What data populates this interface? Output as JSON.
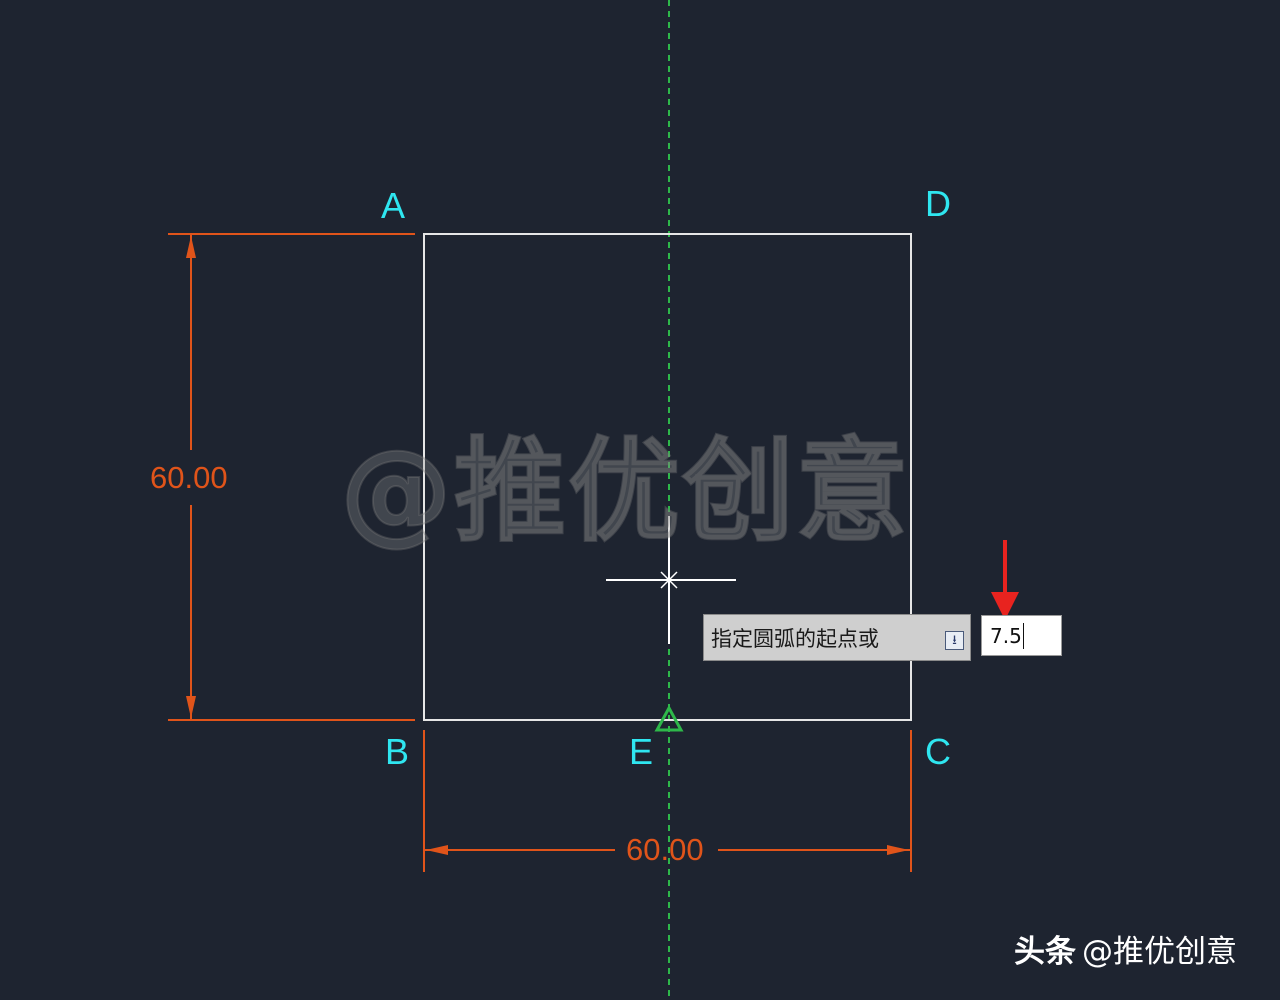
{
  "drawing": {
    "points": {
      "A": "A",
      "B": "B",
      "C": "C",
      "D": "D",
      "E": "E"
    },
    "dimensions": {
      "vertical": "60.00",
      "horizontal": "60.00"
    },
    "colors": {
      "background": "#1e2430",
      "geometry": "#e6e6e6",
      "dimension": "#e0541a",
      "point_label": "#2fe6f0",
      "centerline": "#2eb84a",
      "input_arrow": "#e8231f"
    }
  },
  "watermark": "@推优创意",
  "command_prompt": {
    "text": "指定圆弧的起点或",
    "options_icon": "down-arrow-options-icon",
    "input_value": "7.5"
  },
  "footer": {
    "brand": "头条",
    "account": "@推优创意"
  }
}
